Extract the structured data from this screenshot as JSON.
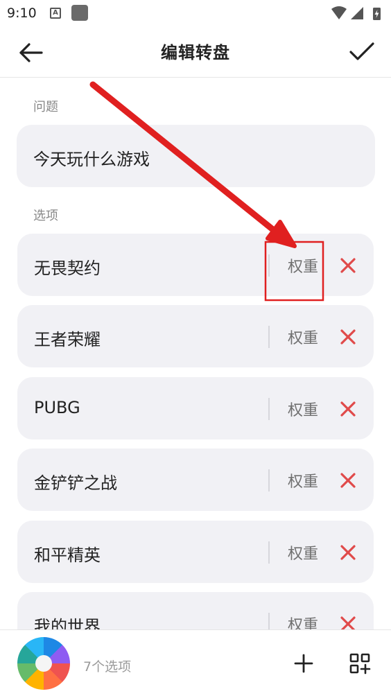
{
  "status_bar": {
    "time": "9:10",
    "a_icon": "A"
  },
  "header": {
    "title": "编辑转盘",
    "back_icon": "arrow-left-icon",
    "confirm_icon": "check-icon"
  },
  "question": {
    "label": "问题",
    "value": "今天玩什么游戏"
  },
  "options": {
    "label": "选项",
    "weight_label": "权重",
    "items": [
      {
        "text": "无畏契约"
      },
      {
        "text": "王者荣耀"
      },
      {
        "text": "PUBG"
      },
      {
        "text": "金铲铲之战"
      },
      {
        "text": "和平精英"
      },
      {
        "text": "我的世界"
      }
    ]
  },
  "bottom_bar": {
    "count_text": "7个选项",
    "add_icon": "plus-icon",
    "grid_icon": "grid-add-icon"
  },
  "colors": {
    "delete": "#e04a4a",
    "annotation": "#e02020",
    "row_bg": "#f1f1f5"
  }
}
